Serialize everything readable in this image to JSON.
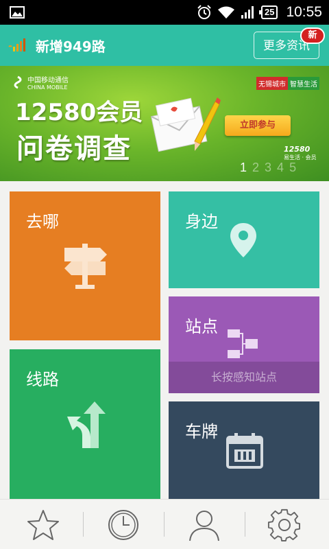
{
  "status_bar": {
    "time": "10:55",
    "battery_level": "25",
    "icons": [
      "gallery-icon",
      "alarm-icon",
      "wifi-icon",
      "signal-icon",
      "battery-icon"
    ]
  },
  "header": {
    "title": "新增949路",
    "more_button_label": "更多资讯",
    "new_badge": "新"
  },
  "banner": {
    "operator_cn": "中国移动通信",
    "operator_en": "CHINA MOBILE",
    "tag_left": "无锡城市",
    "tag_right": "智慧生活",
    "headline_1": "12580会员",
    "headline_2": "问卷调查",
    "cta_label": "立即参与",
    "brand_line_1": "12580",
    "brand_line_2": "易生活 · 会员",
    "pages": [
      "1",
      "2",
      "3",
      "4",
      "5"
    ],
    "active_page": 0
  },
  "tiles": {
    "quna": {
      "label": "去哪",
      "color": "#e67e22",
      "icon": "signpost-icon"
    },
    "shenbian": {
      "label": "身边",
      "color": "#35bfa4",
      "icon": "location-pin-icon"
    },
    "zhandian": {
      "label": "站点",
      "color": "#9b59b6",
      "icon": "station-nodes-icon",
      "hint": "长按感知站点"
    },
    "xianlu": {
      "label": "线路",
      "color": "#27ae60",
      "icon": "route-arrows-icon"
    },
    "chepai": {
      "label": "车牌",
      "color": "#34495e",
      "icon": "calendar-plate-icon"
    }
  },
  "bottom_nav": {
    "items": [
      "star-icon",
      "clock-icon",
      "user-icon",
      "settings-gear-icon"
    ]
  },
  "colors": {
    "header": "#2fbfa4",
    "background": "#f2f2f0",
    "badge": "#d42020"
  }
}
